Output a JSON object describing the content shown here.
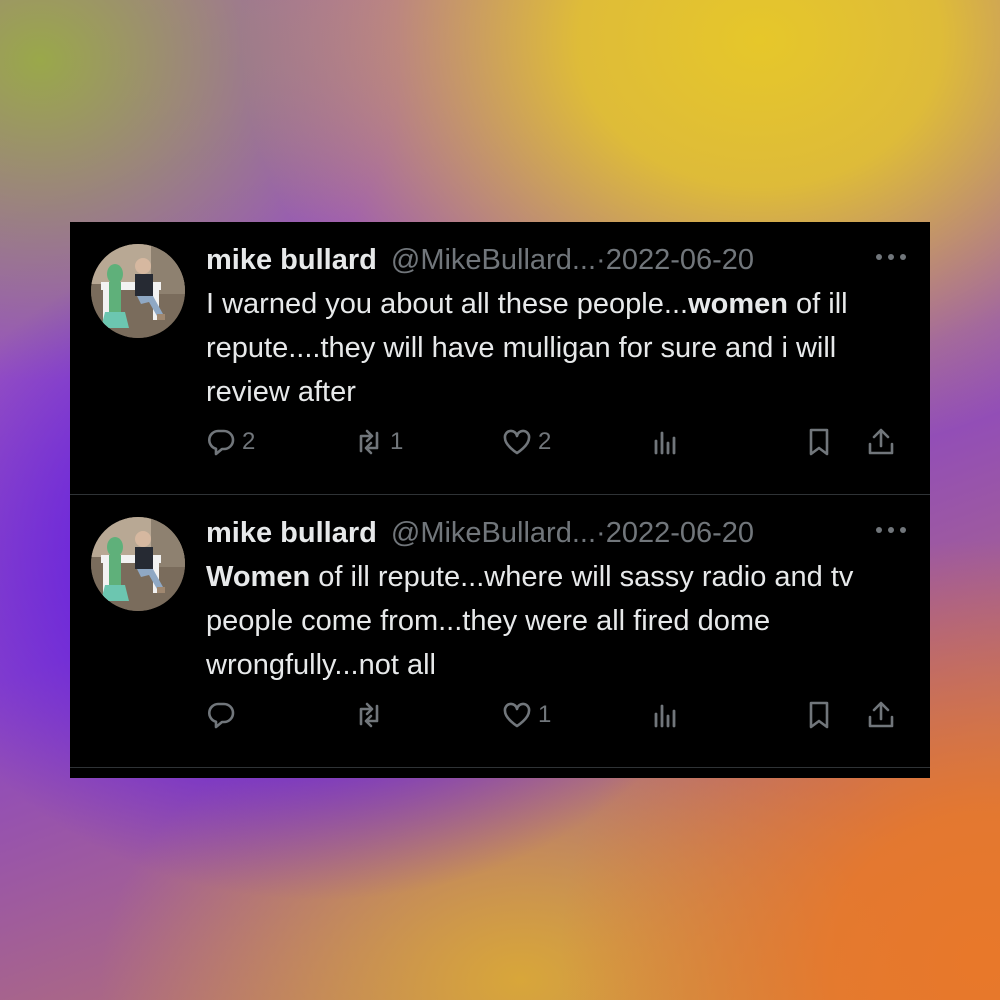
{
  "tweets": [
    {
      "name": "mike bullard",
      "handle": "@MikeBullard...",
      "separator": "·",
      "date": "2022-06-20",
      "text_before": "I warned you about all these people...",
      "text_bold": "women",
      "text_after": " of ill repute....they will have mulligan for sure and i will review after",
      "replies": "2",
      "retweets": "1",
      "likes": "2"
    },
    {
      "name": "mike bullard",
      "handle": "@MikeBullard...",
      "separator": "·",
      "date": "2022-06-20",
      "text_before": "",
      "text_bold": "Women",
      "text_after": " of ill repute...where will sassy radio and tv people come from...they were all fired dome wrongfully...not all",
      "replies": "",
      "retweets": "",
      "likes": "1"
    }
  ],
  "icons": {
    "reply": "reply-icon",
    "retweet": "retweet-icon",
    "like": "heart-icon",
    "views": "views-icon",
    "bookmark": "bookmark-icon",
    "share": "share-icon",
    "more": "more-icon"
  },
  "colors": {
    "card_background": "#000000",
    "primary_text": "#e7e9ea",
    "secondary_text": "#71767b",
    "divider": "#2f3336"
  }
}
